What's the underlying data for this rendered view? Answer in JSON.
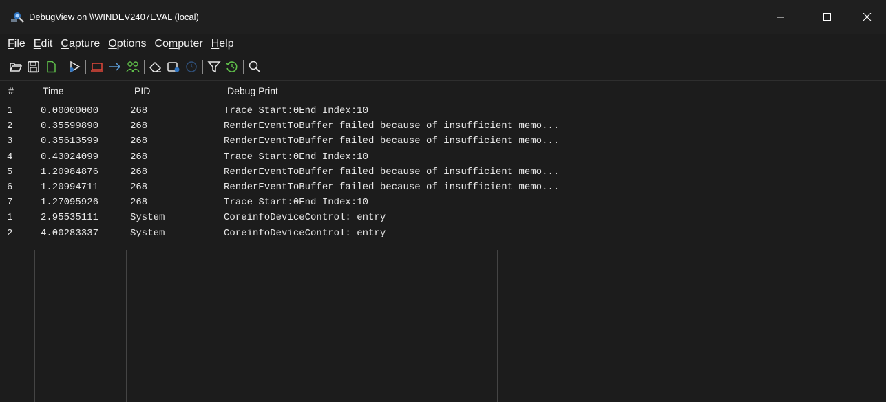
{
  "window": {
    "title": "DebugView on \\\\WINDEV2407EVAL (local)"
  },
  "menu": [
    {
      "label": "File",
      "mnemonic": "F",
      "rest": "ile"
    },
    {
      "label": "Edit",
      "mnemonic": "E",
      "rest": "dit"
    },
    {
      "label": "Capture",
      "mnemonic": "C",
      "rest": "apture"
    },
    {
      "label": "Options",
      "mnemonic": "O",
      "rest": "ptions"
    },
    {
      "label": "Computer",
      "pre": "Co",
      "mnemonic": "m",
      "rest": "puter"
    },
    {
      "label": "Help",
      "mnemonic": "H",
      "rest": "elp"
    }
  ],
  "toolbar": [
    "open-folder-icon",
    "save-icon",
    "new-file-icon",
    "|",
    "capture-icon",
    "|",
    "capture-kernel-icon",
    "pass-through-icon",
    "capture-global-icon",
    "|",
    "clear-icon",
    "autoscroll-icon",
    "clock-icon",
    "|",
    "filter-icon",
    "history-icon",
    "|",
    "find-icon"
  ],
  "colors": {
    "background": "#1c1c1c",
    "text": "#e6e6e6",
    "accent_blue": "#5b9bd5",
    "accent_red": "#e0463a",
    "accent_green": "#5fbf4a"
  },
  "table": {
    "columns": [
      "#",
      "Time",
      "PID",
      "Debug Print"
    ],
    "rows": [
      {
        "num": "1",
        "time": "0.00000000",
        "pid": "268",
        "msg": "Trace Start:0End Index:10"
      },
      {
        "num": "2",
        "time": "0.35599890",
        "pid": "268",
        "msg": "RenderEventToBuffer failed because of insufficient memo..."
      },
      {
        "num": "3",
        "time": "0.35613599",
        "pid": "268",
        "msg": "RenderEventToBuffer failed because of insufficient memo..."
      },
      {
        "num": "4",
        "time": "0.43024099",
        "pid": "268",
        "msg": "Trace Start:0End Index:10"
      },
      {
        "num": "5",
        "time": "1.20984876",
        "pid": "268",
        "msg": "RenderEventToBuffer failed because of insufficient memo..."
      },
      {
        "num": "6",
        "time": "1.20994711",
        "pid": "268",
        "msg": "RenderEventToBuffer failed because of insufficient memo..."
      },
      {
        "num": "7",
        "time": "1.27095926",
        "pid": "268",
        "msg": "Trace Start:0End Index:10"
      },
      {
        "num": "1",
        "time": "2.95535111",
        "pid": "System",
        "msg": "CoreinfoDeviceControl: entry"
      },
      {
        "num": "2",
        "time": "4.00283337",
        "pid": "System",
        "msg": "CoreinfoDeviceControl: entry"
      }
    ]
  }
}
